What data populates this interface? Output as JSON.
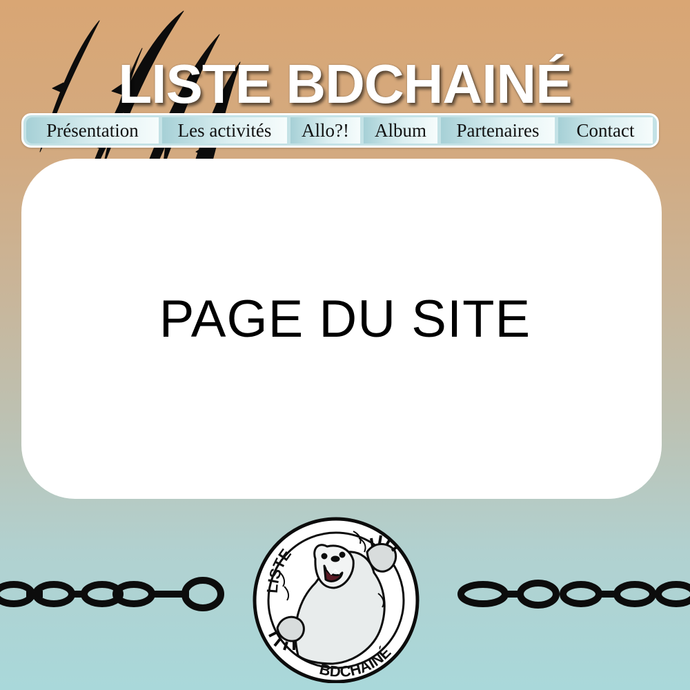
{
  "header": {
    "title": "LISTE BDCHAINÉ"
  },
  "nav": {
    "items": [
      {
        "label": "Présentation"
      },
      {
        "label": "Les activités"
      },
      {
        "label": "Allo?!"
      },
      {
        "label": "Album"
      },
      {
        "label": "Partenaires"
      },
      {
        "label": "Contact"
      }
    ]
  },
  "main": {
    "page_label": "PAGE DU SITE"
  },
  "logo": {
    "top_text": "LISTE",
    "bottom_text": "BDCHAINÉ"
  },
  "colors": {
    "background_top": "#d9a674",
    "background_bottom": "#a9d8da",
    "nav_background": "#c4e2e6",
    "panel": "#ffffff"
  },
  "icons": [
    "claw-marks-icon",
    "chain-icon",
    "bear-logo-icon"
  ]
}
